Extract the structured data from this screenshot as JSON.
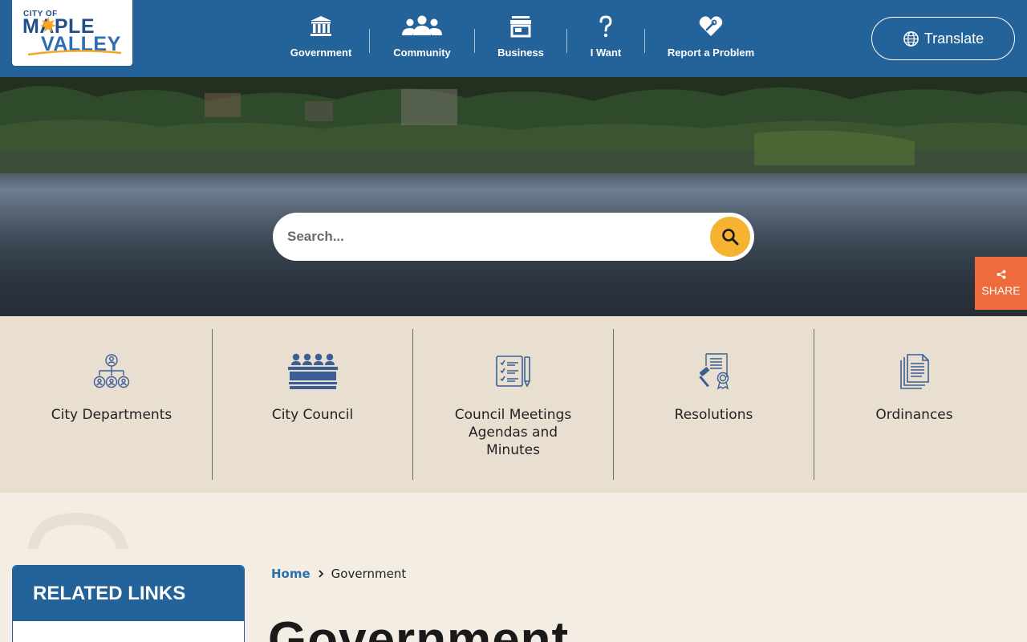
{
  "logo": {
    "line_small": "CITY OF",
    "line1": "MAPLE",
    "line2": "VALLEY"
  },
  "nav": [
    {
      "label": "Government",
      "icon": "government-building-icon"
    },
    {
      "label": "Community",
      "icon": "people-group-icon"
    },
    {
      "label": "Business",
      "icon": "storefront-icon"
    },
    {
      "label": "I Want",
      "icon": "question-mark-icon"
    },
    {
      "label": "Report a Problem",
      "icon": "heart-wrench-icon"
    }
  ],
  "translate": {
    "label": "Translate",
    "icon": "globe-icon"
  },
  "search": {
    "placeholder": "Search...",
    "icon": "search-icon"
  },
  "share": {
    "label": "SHARE",
    "icon": "share-icon"
  },
  "quick_links": [
    {
      "label": "City Departments",
      "icon": "org-chart-icon"
    },
    {
      "label": "City Council",
      "icon": "council-dais-icon"
    },
    {
      "label": "Council Meetings Agendas and Minutes",
      "icon": "agenda-checklist-icon"
    },
    {
      "label": "Resolutions",
      "icon": "gavel-document-icon"
    },
    {
      "label": "Ordinances",
      "icon": "documents-stack-icon"
    }
  ],
  "related_links": {
    "title": "RELATED LINKS"
  },
  "breadcrumb": {
    "home": "Home",
    "current": "Government"
  },
  "page": {
    "title": "Government"
  },
  "colors": {
    "brand_blue": "#24629a",
    "accent_gold": "#f6b331",
    "share_orange": "#ee6b3b",
    "quick_bg": "#e9dfd1",
    "page_bg": "#f4ede4"
  }
}
